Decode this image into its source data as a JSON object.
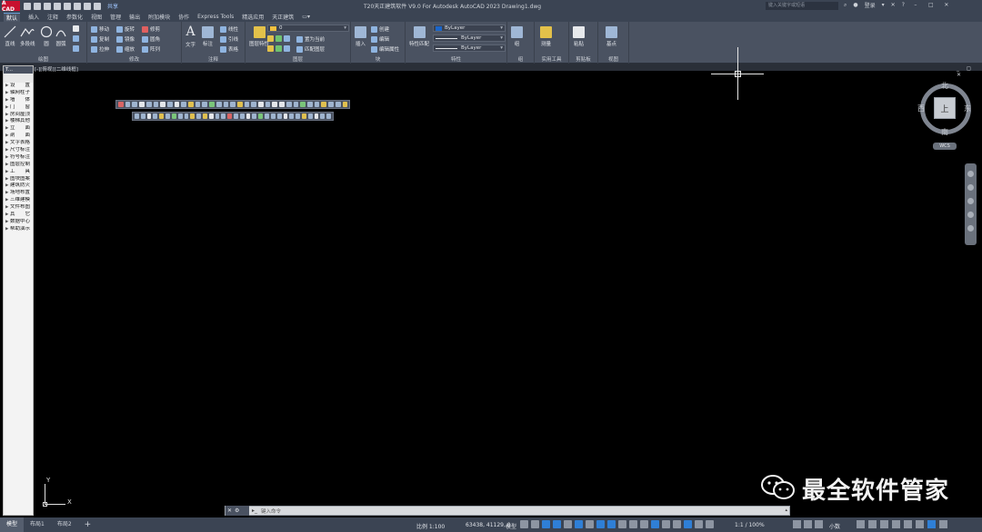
{
  "app": {
    "logo": "A CAD",
    "title": "T20天正建筑软件 V9.0 For Autodesk AutoCAD 2023    Drawing1.dwg",
    "share_label": "共享",
    "search_placeholder": "键入关键字或短语",
    "user_label": "登录",
    "help_label": "?"
  },
  "ribbon_tabs": [
    "默认",
    "插入",
    "注释",
    "参数化",
    "视图",
    "管理",
    "输出",
    "附加模块",
    "协作",
    "Express Tools",
    "精选应用",
    "天正建筑"
  ],
  "ribbon_active_tab": "默认",
  "ribbon": {
    "draw": {
      "title": "绘图",
      "line": "直线",
      "polyline": "多段线",
      "circle": "圆",
      "arc": "圆弧"
    },
    "modify": {
      "title": "修改",
      "move": "移动",
      "rotate": "旋转",
      "trim": "修剪",
      "copy": "复制",
      "mirror": "镜像",
      "fillet": "圆角",
      "stretch": "拉伸",
      "scale": "缩放",
      "array": "阵列"
    },
    "annotation": {
      "title": "注释",
      "text": "文字",
      "dimension": "标注",
      "linear": "线性",
      "leader": "引线",
      "table": "表格"
    },
    "layers": {
      "title": "图层",
      "layer_props": "图层特性",
      "current_layer": "0",
      "make_current": "置为当前",
      "match_layer": "匹配图层"
    },
    "block": {
      "title": "块",
      "insert": "插入",
      "create": "创建",
      "edit": "编辑",
      "edit_attr": "编辑属性"
    },
    "properties": {
      "title": "特性",
      "match": "特性匹配",
      "color": "ByLayer",
      "linetype": "ByLayer",
      "lineweight": "ByLayer"
    },
    "groups": {
      "title": "组",
      "group": "组"
    },
    "utilities": {
      "title": "实用工具",
      "measure": "测量"
    },
    "clipboard": {
      "title": "剪贴板",
      "paste": "粘贴"
    },
    "view": {
      "title": "视图",
      "base": "基点"
    }
  },
  "viewport": {
    "label": "[-][俯视][二维线框]",
    "controls": "_ ◻ ✕"
  },
  "palette": {
    "title": "T...",
    "items": [
      "设　　置",
      "轴网柱子",
      "墙　　体",
      "门　　窗",
      "房间屋顶",
      "楼梯其他",
      "立　　面",
      "剖　　面",
      "文字表格",
      "尺寸标注",
      "符号标注",
      "图层控制",
      "工　　具",
      "图块图案",
      "建筑防火",
      "场地布置",
      "三维建模",
      "文件布图",
      "其　　它",
      "数据中心",
      "帮助演示"
    ]
  },
  "viewcube": {
    "north": "北",
    "south": "南",
    "east": "东",
    "west": "西",
    "top": "上",
    "wcs": "WCS"
  },
  "ucs": {
    "x": "X",
    "y": "Y"
  },
  "watermark": {
    "text": "最全软件管家"
  },
  "command": {
    "placeholder": "键入命令"
  },
  "status": {
    "layouts": [
      "模型",
      "布局1",
      "布局2"
    ],
    "add_layout": "+",
    "scale": "比例 1:100",
    "coords": "63438, 41129, 0",
    "model": "模型",
    "zoom": "1:1 / 100%",
    "text_size": "小数"
  }
}
